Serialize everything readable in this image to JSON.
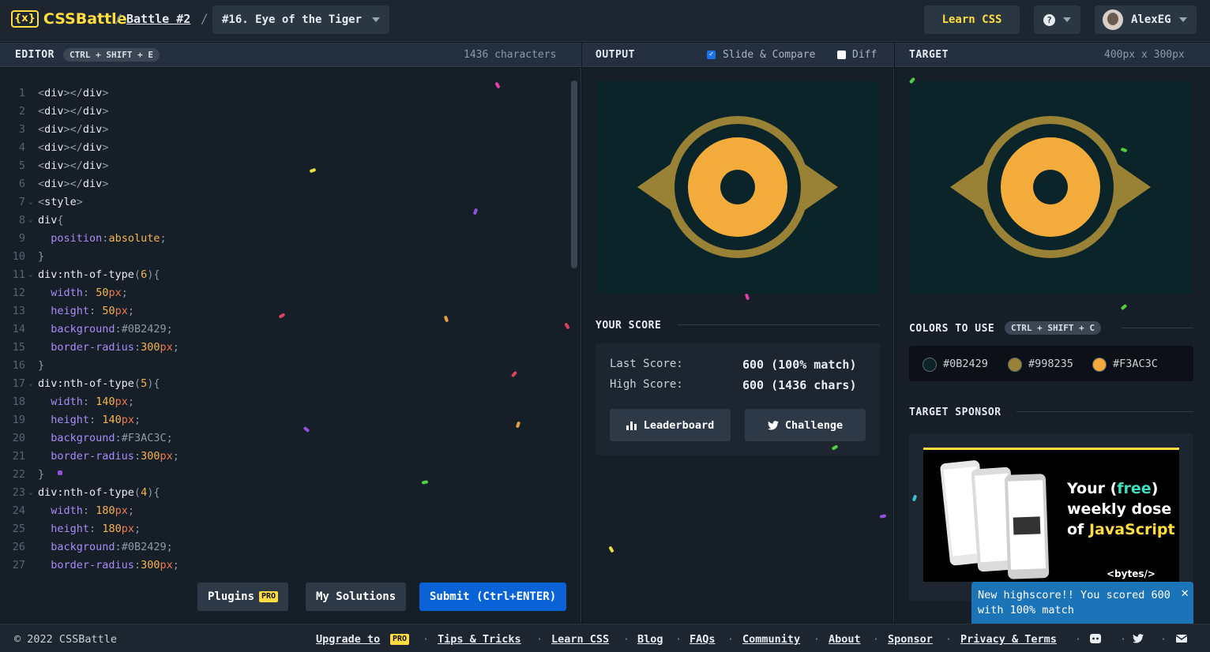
{
  "header": {
    "logo_text": "CSSBattle",
    "battle": "Battle #2",
    "challenge": "#16. Eye of the Tiger",
    "learn_css": "Learn CSS",
    "help_label": "?",
    "username": "AlexEG"
  },
  "editor": {
    "title": "EDITOR",
    "shortcut": "CTRL + SHIFT + E",
    "char_count": "1436 characters",
    "lines": [
      "<div></div>",
      "<div></div>",
      "<div></div>",
      "<div></div>",
      "<div></div>",
      "<div></div>",
      "<style>",
      "div{",
      "  position:absolute;",
      "}",
      "div:nth-of-type(6){",
      "  width: 50px;",
      "  height: 50px;",
      "  background:#0B2429;",
      "  border-radius:300px;",
      "}",
      "div:nth-of-type(5){",
      "  width: 140px;",
      "  height: 140px;",
      "  background:#F3AC3C;",
      "  border-radius:300px;",
      "}",
      "div:nth-of-type(4){",
      "  width: 180px;",
      "  height: 180px;",
      "  background:#0B2429;",
      "  border-radius:300px;"
    ],
    "plugins_label": "Plugins",
    "pro_badge": "PRO",
    "solutions_label": "My Solutions",
    "submit_label": "Submit (Ctrl+ENTER)"
  },
  "output": {
    "title": "OUTPUT",
    "slide_compare": "Slide & Compare",
    "slide_checked": true,
    "diff": "Diff",
    "diff_checked": false
  },
  "target": {
    "title": "TARGET",
    "size": "400px x 300px"
  },
  "score": {
    "title": "YOUR SCORE",
    "last_label": "Last Score:",
    "last_value": "600 (100% match)",
    "high_label": "High Score:",
    "high_value": "600 (1436 chars)",
    "leaderboard": "Leaderboard",
    "challenge": "Challenge"
  },
  "colors": {
    "title": "COLORS TO USE",
    "shortcut": "CTRL + SHIFT + C",
    "items": [
      {
        "hex": "#0B2429"
      },
      {
        "hex": "#998235"
      },
      {
        "hex": "#F3AC3C"
      }
    ]
  },
  "sponsor": {
    "title": "TARGET SPONSOR",
    "line1_a": "Your (",
    "line1_b": "free",
    "line1_c": ")",
    "line2": "weekly dose",
    "line3_a": "of ",
    "line3_b": "JavaScript",
    "brand": "<bytes/>"
  },
  "toast": {
    "text": "New highscore!! You scored 600 with 100% match",
    "progress": 0.7
  },
  "footer": {
    "copyright": "© 2022 CSSBattle",
    "links": [
      "Upgrade to",
      "Tips & Tricks",
      "Learn CSS",
      "Blog",
      "FAQs",
      "Community",
      "About",
      "Sponsor",
      "Privacy & Terms"
    ]
  },
  "theme": {
    "accent": "#ffdd40",
    "submit": "#0a63d6",
    "eye_bg": "#0B2429",
    "eye_gold": "#998235",
    "eye_orange": "#F3AC3C"
  }
}
